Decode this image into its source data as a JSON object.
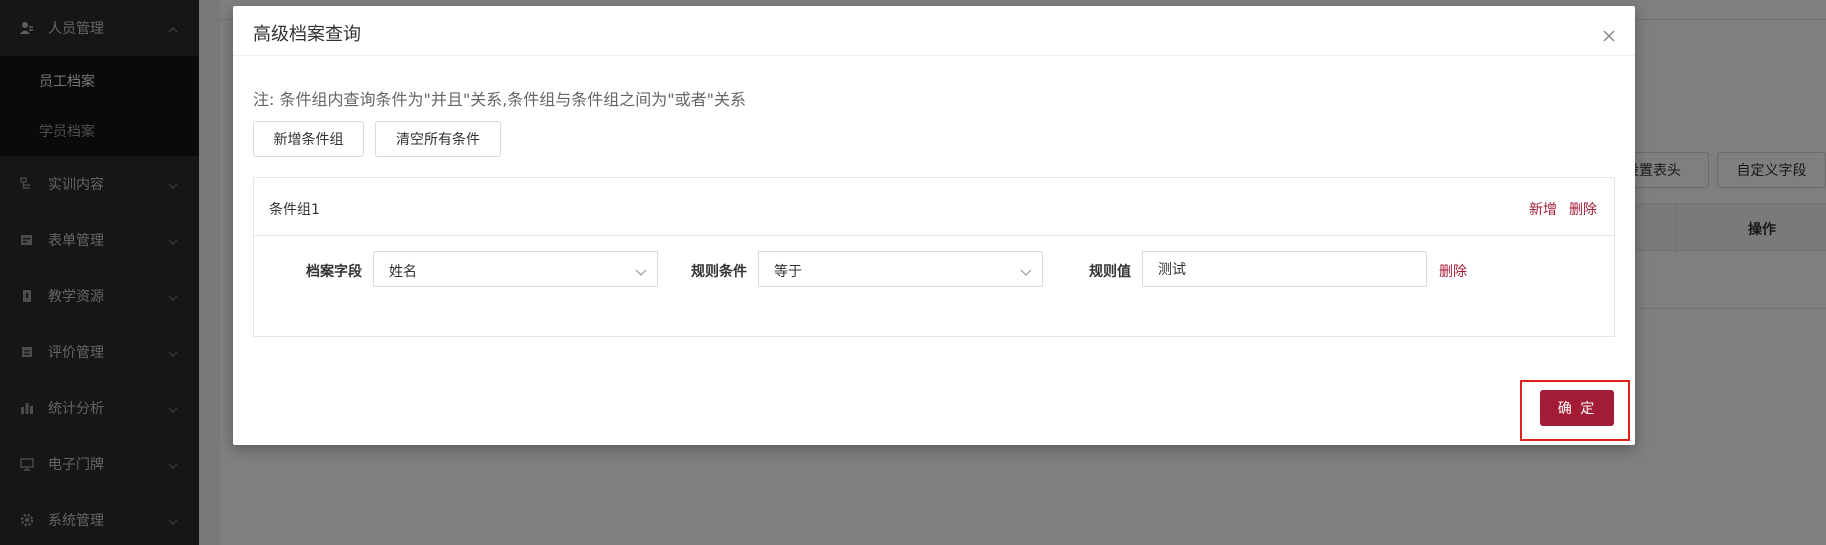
{
  "sidebar": {
    "items": [
      {
        "label": "人员管理",
        "icon": "user-icon",
        "expanded": true
      },
      {
        "label": "实训内容",
        "icon": "flowchart-icon"
      },
      {
        "label": "表单管理",
        "icon": "form-icon"
      },
      {
        "label": "教学资源",
        "icon": "book-icon"
      },
      {
        "label": "评价管理",
        "icon": "evaluation-icon"
      },
      {
        "label": "统计分析",
        "icon": "bar-chart-icon"
      },
      {
        "label": "电子门牌",
        "icon": "monitor-icon"
      },
      {
        "label": "系统管理",
        "icon": "gear-icon"
      }
    ],
    "subitems": [
      {
        "label": "员工档案",
        "active": true
      },
      {
        "label": "学员档案"
      }
    ]
  },
  "background": {
    "buttons": [
      "设置表头",
      "自定义字段"
    ],
    "table_header_action": "操作"
  },
  "modal": {
    "title": "高级档案查询",
    "note": "注: 条件组内查询条件为\"并且\"关系,条件组与条件组之间为\"或者\"关系",
    "add_group_label": "新增条件组",
    "clear_all_label": "清空所有条件",
    "group": {
      "title": "条件组1",
      "add_label": "新增",
      "delete_label": "删除",
      "condition": {
        "field_label": "档案字段",
        "field_value": "姓名",
        "rule_label": "规则条件",
        "rule_value": "等于",
        "value_label": "规则值",
        "value_value": "测试",
        "delete_label": "删除"
      }
    },
    "confirm_label": "确 定"
  },
  "colors": {
    "accent": "#a31c35",
    "sidebar_bg": "#2d2d2d",
    "highlight": "#e0211b"
  }
}
